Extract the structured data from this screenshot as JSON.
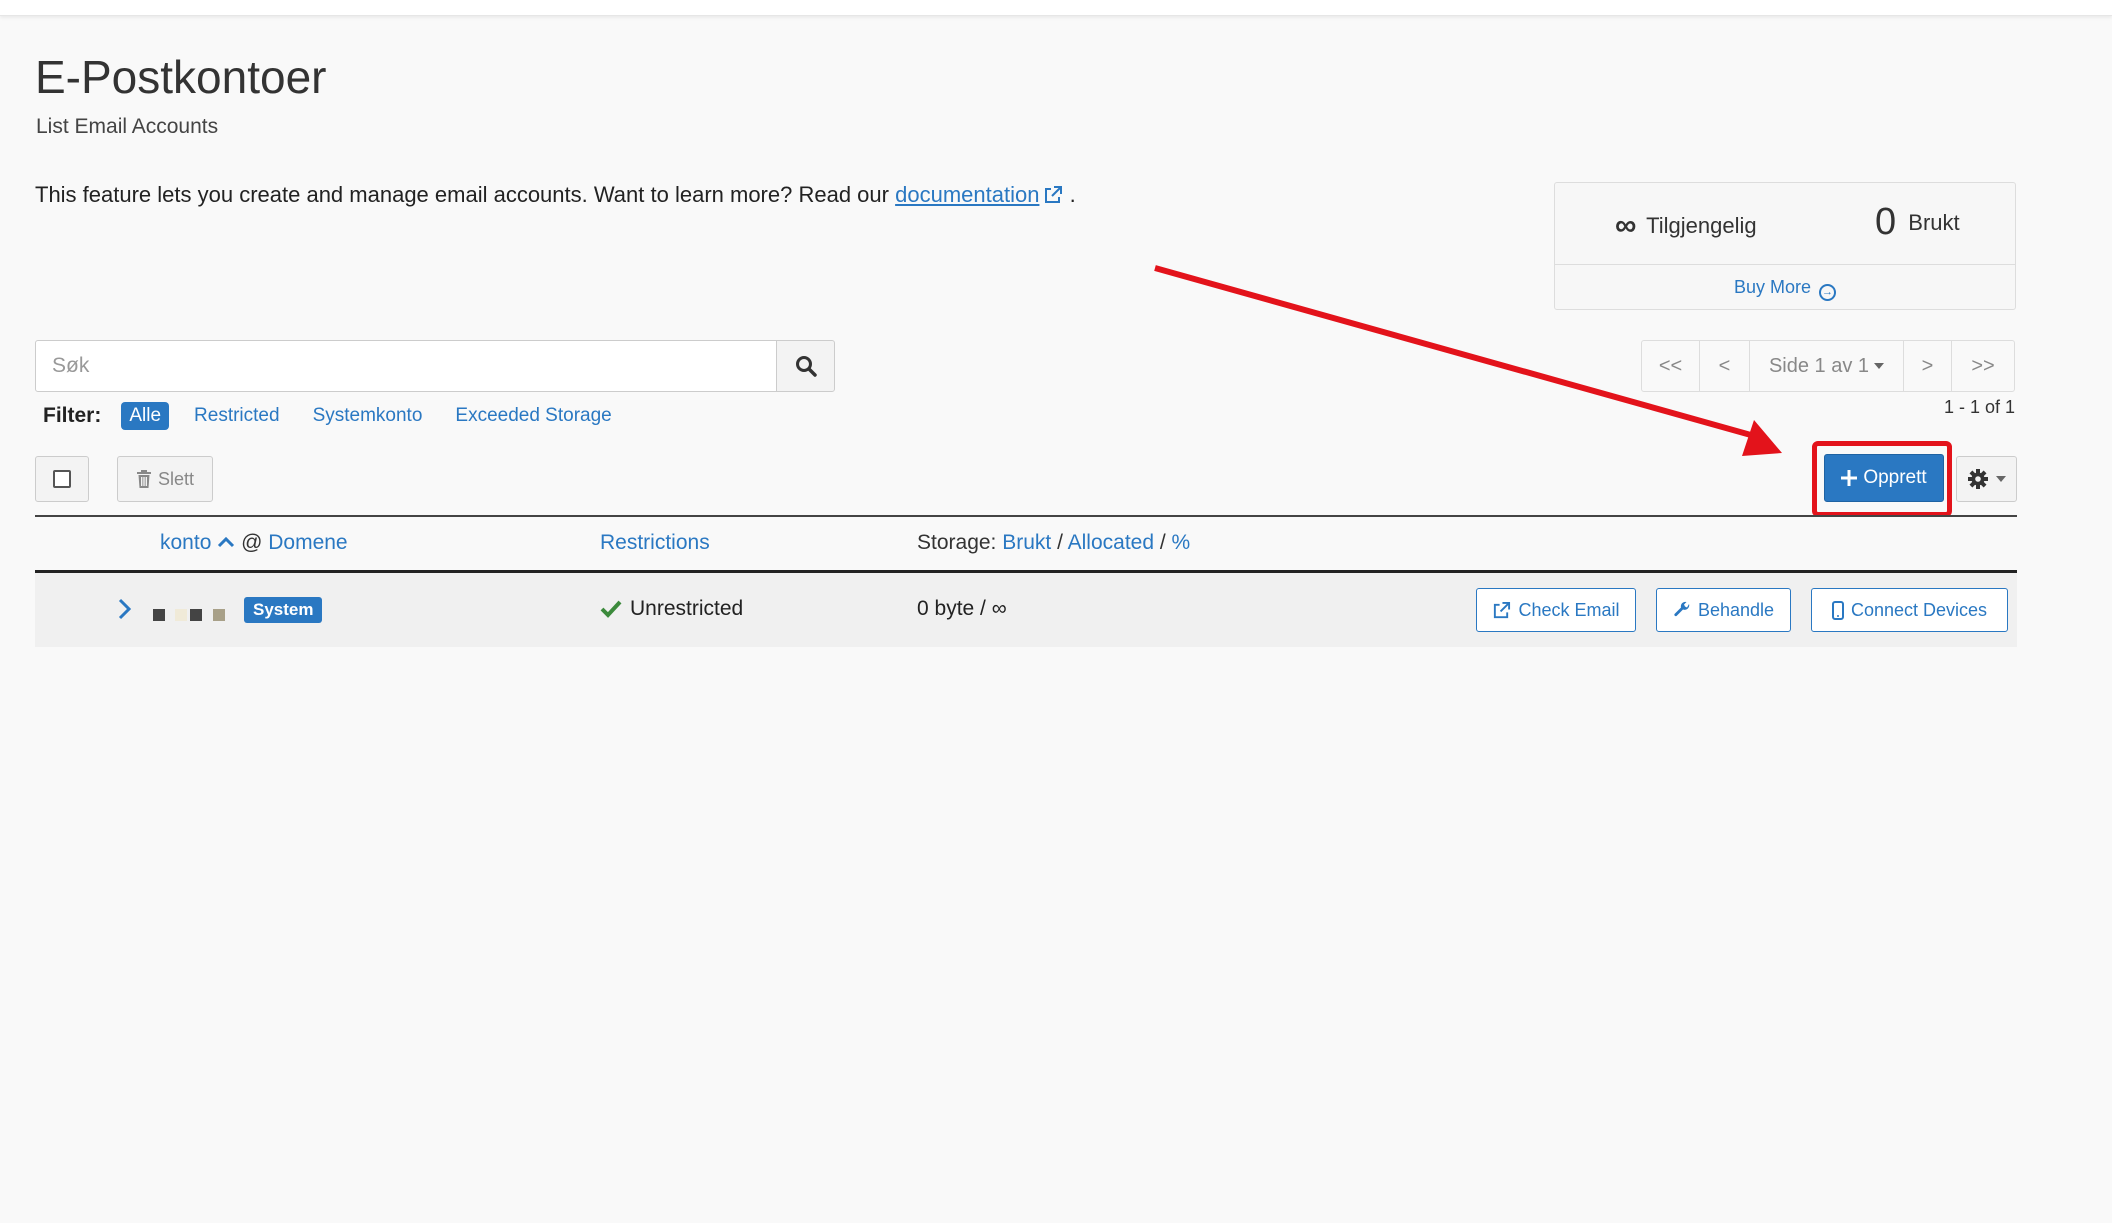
{
  "header": {
    "title": "E-Postkontoer",
    "subtitle": "List Email Accounts"
  },
  "intro": {
    "text": "This feature lets you create and manage email accounts. Want to learn more? Read our",
    "link_label": "documentation",
    "suffix": "."
  },
  "stats": {
    "available_symbol": "∞",
    "available_label": "Tilgjengelig",
    "used_value": "0",
    "used_label": "Brukt",
    "buy_more_label": "Buy More"
  },
  "search": {
    "placeholder": "Søk"
  },
  "filter": {
    "label": "Filter:",
    "options": [
      "Alle",
      "Restricted",
      "Systemkonto",
      "Exceeded Storage"
    ],
    "active": "Alle"
  },
  "pagination": {
    "first": "<<",
    "prev": "<",
    "page_label": "Side 1 av 1",
    "next": ">",
    "last": ">>",
    "count": "1 - 1 of 1"
  },
  "toolbar": {
    "delete_label": "Slett",
    "create_label": "Opprett"
  },
  "table": {
    "col_account": "konto",
    "col_at": "@",
    "col_domain": "Domene",
    "col_restrictions": "Restrictions",
    "col_storage_prefix": "Storage:",
    "col_storage_used": "Brukt",
    "col_storage_sep": "/",
    "col_storage_allocated": "Allocated",
    "col_storage_percent": "%",
    "rows": [
      {
        "badge": "System",
        "restriction": "Unrestricted",
        "storage": "0 byte / ∞",
        "actions": {
          "check_email": "Check Email",
          "manage": "Behandle",
          "connect_devices": "Connect Devices"
        }
      }
    ]
  },
  "colors": {
    "accent": "#2a78c2",
    "highlight": "#e3131b",
    "success": "#3c8a3c"
  }
}
